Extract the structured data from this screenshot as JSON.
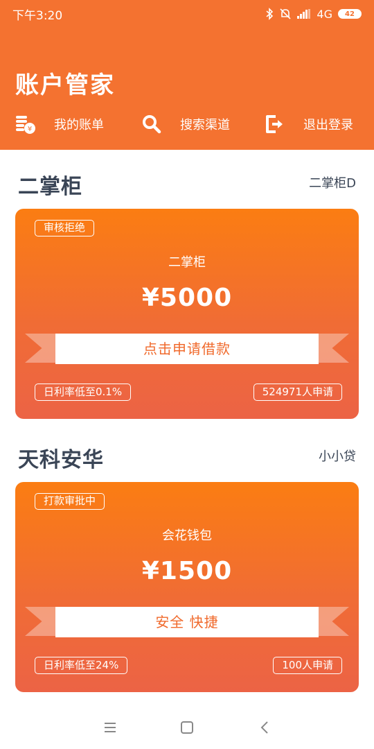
{
  "status_bar": {
    "time": "下午3:20",
    "network": "4G",
    "battery": "42"
  },
  "app": {
    "title": "账户管家"
  },
  "nav": {
    "items": [
      {
        "label": "我的账单",
        "icon": "bill-coins-icon"
      },
      {
        "label": "搜索渠道",
        "icon": "search-icon"
      },
      {
        "label": "退出登录",
        "icon": "logout-icon"
      }
    ]
  },
  "sections": [
    {
      "title": "二掌柜",
      "subtitle": "二掌柜D",
      "card": {
        "status": "审核拒绝",
        "product": "二掌柜",
        "amount": "¥5000",
        "button": "点击申请借款",
        "rate": "日利率低至0.1%",
        "applicants": "524971人申请"
      }
    },
    {
      "title": "天科安华",
      "subtitle": "小小贷",
      "card": {
        "status": "打款审批中",
        "product": "会花钱包",
        "amount": "¥1500",
        "button": "安全 快捷",
        "rate": "日利率低至24%",
        "applicants": "100人申请"
      }
    }
  ],
  "colors": {
    "header": "#f47230",
    "card_top": "#fb7d12",
    "card_bottom": "#ec6345",
    "title_text": "#3a4556",
    "button_text": "#f0692b"
  }
}
